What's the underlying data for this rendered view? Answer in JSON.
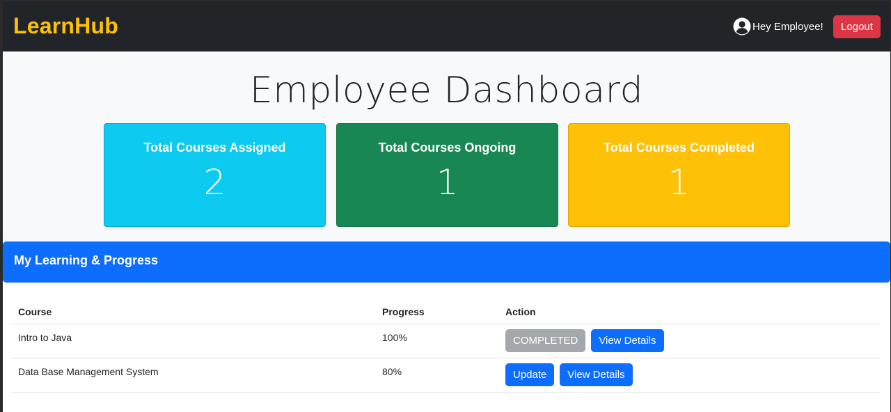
{
  "navbar": {
    "brand": "LearnHub",
    "greeting": "Hey Employee!",
    "logout_label": "Logout"
  },
  "page": {
    "title": "Employee Dashboard"
  },
  "stats": [
    {
      "label": "Total Courses Assigned",
      "value": "2",
      "color": "#0dcaf0"
    },
    {
      "label": "Total Courses Ongoing",
      "value": "1",
      "color": "#198754"
    },
    {
      "label": "Total Courses Completed",
      "value": "1",
      "color": "#ffc107"
    }
  ],
  "learning": {
    "header": "My Learning & Progress",
    "columns": {
      "course": "Course",
      "progress": "Progress",
      "action": "Action"
    },
    "rows": [
      {
        "course": "Intro to Java",
        "progress": "100%",
        "status_label": "COMPLETED",
        "details_label": "View Details"
      },
      {
        "course": "Data Base Management System",
        "progress": "80%",
        "update_label": "Update",
        "details_label": "View Details"
      }
    ]
  },
  "colors": {
    "navbar_bg": "#212529",
    "brand": "#ffc107",
    "logout": "#dc3545",
    "primary": "#0d6efd",
    "completed_badge": "#a3a8ad"
  },
  "icons": {
    "user": "user-circle-icon"
  }
}
